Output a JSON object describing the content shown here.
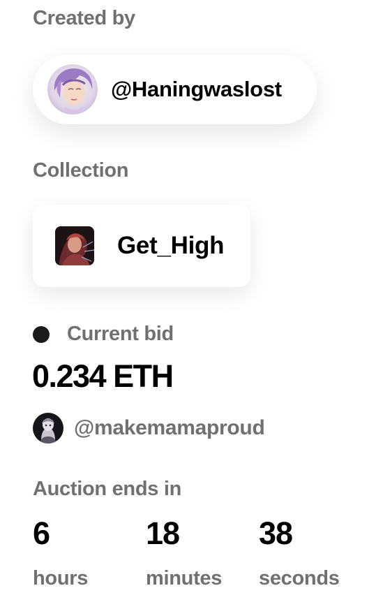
{
  "creator": {
    "label": "Created by",
    "username": "@Haningwaslost"
  },
  "collection": {
    "label": "Collection",
    "name": "Get_High"
  },
  "bid": {
    "label": "Current bid",
    "amount": "0.234 ETH",
    "bidder": "@makemamaproud"
  },
  "auction": {
    "label": "Auction ends in",
    "hours": "6",
    "hours_unit": "hours",
    "minutes": "18",
    "minutes_unit": "minutes",
    "seconds": "38",
    "seconds_unit": "seconds"
  }
}
